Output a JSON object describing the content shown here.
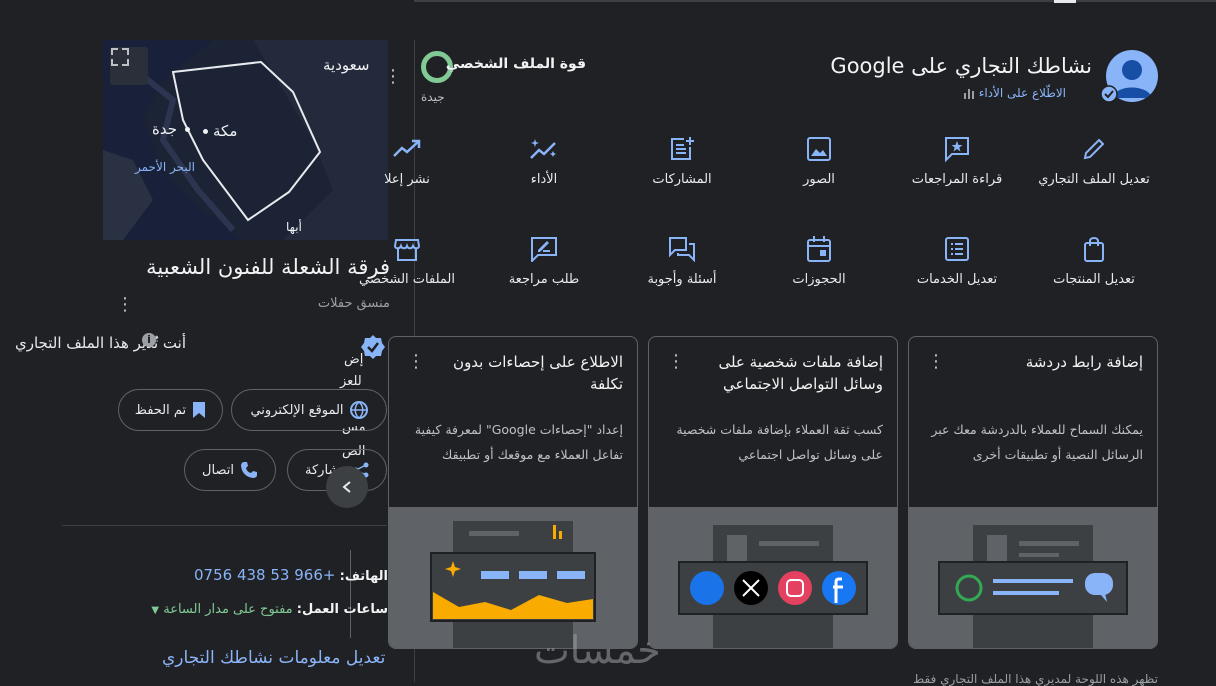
{
  "header": {
    "title": "نشاطك التجاري على Google",
    "performance_link": "الاطّلاع على الأداء"
  },
  "profile_strength": {
    "title": "قوة الملف الشخصي",
    "rating": "جيدة"
  },
  "actions_row1": [
    {
      "label": "تعديل الملف التجاري",
      "icon": "pencil-icon"
    },
    {
      "label": "قراءة المراجعات",
      "icon": "review-star-icon"
    },
    {
      "label": "الصور",
      "icon": "image-icon"
    },
    {
      "label": "المشاركات",
      "icon": "post-add-icon"
    },
    {
      "label": "الأداء",
      "icon": "sparkle-trend-icon"
    },
    {
      "label": "نشر إعلا",
      "icon": "trending-up-icon"
    }
  ],
  "actions_row2": [
    {
      "label": "تعديل المنتجات",
      "icon": "shopping-bag-icon"
    },
    {
      "label": "تعديل الخدمات",
      "icon": "list-icon"
    },
    {
      "label": "الحجوزات",
      "icon": "calendar-icon"
    },
    {
      "label": "أسئلة وأجوبة",
      "icon": "qa-icon"
    },
    {
      "label": "طلب مراجعة",
      "icon": "rate-review-icon"
    },
    {
      "label": "الملفات الشخصي",
      "icon": "storefront-icon"
    }
  ],
  "cards": [
    {
      "title": "إضافة رابط دردشة",
      "desc": "يمكنك السماح للعملاء بالدردشة معك عبر الرسائل النصية أو تطبيقات أخرى"
    },
    {
      "title": "إضافة ملفات شخصية على وسائل التواصل الاجتماعي",
      "desc": "كسب ثقة العملاء بإضافة ملفات شخصية على وسائل تواصل اجتماعي"
    },
    {
      "title": "الاطلاع على إحصاءات بدون تكلفة",
      "desc": "إعداد \"إحصاءات Google\" لمعرفة كيفية تفاعل العملاء مع موقعك أو تطبيقك"
    }
  ],
  "map": {
    "labels": {
      "country": "سعودية",
      "jeddah": "جدة",
      "makkah": "مكة",
      "red_sea": "البحر الأحمر",
      "abha": "أبها"
    }
  },
  "business": {
    "name": "فرقة الشعلة للفنون الشعبية",
    "category": "منسق حفلات",
    "manage_text": "أنت تُدير هذا الملف التجاري",
    "website_label": "الموقع الإلكتروني",
    "saved_label": "تم الحفظ",
    "share_label": "مشاركة",
    "call_label": "اتصال",
    "phone_key": "الهاتف:",
    "phone_value": "+966 53 438 0756",
    "hours_key": "ساعات العمل:",
    "hours_value": "مفتوح على مدار الساعة",
    "edit_link": "تعديل معلومات نشاطك التجاري"
  },
  "partial_texts": {
    "p1": "إض",
    "p2": "للعز",
    "p3": "مس",
    "p4": "الص"
  },
  "footer_text": "تظهر هذه اللوحة لمديري هذا الملف التجاري فقط",
  "watermark": "خمسات",
  "colors": {
    "accent": "#8ab4f8",
    "positive": "#81c995",
    "background": "#202124"
  }
}
